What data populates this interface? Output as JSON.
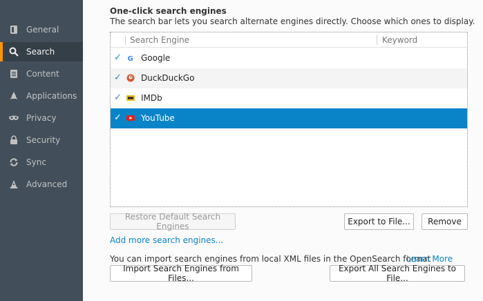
{
  "sidebar": {
    "items": [
      {
        "label": "General",
        "icon": "general-icon"
      },
      {
        "label": "Search",
        "icon": "search-icon",
        "selected": true
      },
      {
        "label": "Content",
        "icon": "content-icon"
      },
      {
        "label": "Applications",
        "icon": "applications-icon"
      },
      {
        "label": "Privacy",
        "icon": "privacy-icon"
      },
      {
        "label": "Security",
        "icon": "security-icon"
      },
      {
        "label": "Sync",
        "icon": "sync-icon"
      },
      {
        "label": "Advanced",
        "icon": "advanced-icon"
      }
    ],
    "accent_color": "#ff9500"
  },
  "section": {
    "title": "One-click search engines",
    "description": "The search bar lets you search alternate engines directly. Choose which ones to display."
  },
  "table": {
    "columns": [
      "Search Engine",
      "Keyword"
    ],
    "rows": [
      {
        "name": "Google",
        "keyword": "",
        "checked": true,
        "icon": "google-icon"
      },
      {
        "name": "DuckDuckGo",
        "keyword": "",
        "checked": true,
        "icon": "duckduckgo-icon"
      },
      {
        "name": "IMDb",
        "keyword": "",
        "checked": true,
        "icon": "imdb-icon"
      },
      {
        "name": "YouTube",
        "keyword": "",
        "checked": true,
        "icon": "youtube-icon",
        "selected": true
      }
    ],
    "selection_color": "#0a84c8"
  },
  "buttons": {
    "restore_defaults": "Restore Default Search Engines",
    "export_to_file": "Export to File...",
    "remove": "Remove",
    "import_from_files": "Import Search Engines from Files...",
    "export_all": "Export All Search Engines to File..."
  },
  "links": {
    "add_more": "Add more search engines...",
    "learn_more": "Learn More"
  },
  "import_info": "You can import search engines from local XML files in the OpenSearch format"
}
